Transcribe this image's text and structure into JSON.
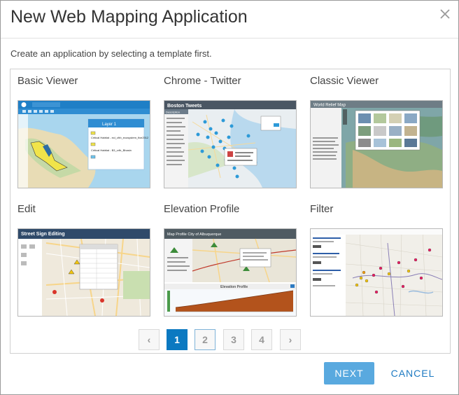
{
  "dialog": {
    "title": "New Web Mapping Application",
    "instruction": "Create an application by selecting a template first."
  },
  "templates": [
    {
      "name": "Basic Viewer",
      "thumb_icon": "basic-viewer-map-thumbnail"
    },
    {
      "name": "Chrome - Twitter",
      "thumb_icon": "chrome-twitter-map-thumbnail"
    },
    {
      "name": "Classic Viewer",
      "thumb_icon": "classic-viewer-map-thumbnail"
    },
    {
      "name": "Edit",
      "thumb_icon": "edit-map-thumbnail"
    },
    {
      "name": "Elevation Profile",
      "thumb_icon": "elevation-profile-map-thumbnail"
    },
    {
      "name": "Filter",
      "thumb_icon": "filter-map-thumbnail"
    }
  ],
  "thumb_text": {
    "basic_layer_title": "Layer 1",
    "basic_layer_a": "Critical Habitat - ecl_cfrb_ecosystem_fixe2012",
    "basic_layer_b": "Critical Habitat - B3_crfb_Bhasin",
    "twitter_title": "Boston Tweets",
    "twitter_tab": "Description",
    "classic_title": "World Relief Map",
    "edit_title": "Street Sign Editing",
    "elevation_title": "Map Profile City of Albuquerque",
    "elevation_chart_title": "Elevation Profile"
  },
  "pagination": {
    "prev": "‹",
    "pages": [
      "1",
      "2",
      "3",
      "4"
    ],
    "next": "›",
    "current": 1
  },
  "buttons": {
    "next": "NEXT",
    "cancel": "CANCEL"
  },
  "colors": {
    "accent": "#0b79c1",
    "next_button": "#59a9df",
    "cancel_text": "#1d7ac2"
  }
}
